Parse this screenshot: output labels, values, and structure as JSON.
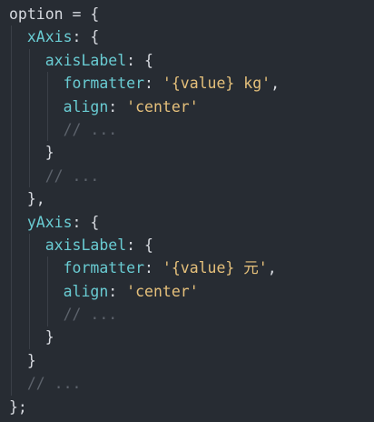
{
  "editor": {
    "background": "#272c33",
    "colors": {
      "plain": "#d7dae0",
      "key": "#69cbd2",
      "string": "#e5c07b",
      "comment": "#5d636c"
    },
    "lines": [
      {
        "indent": 0,
        "tokens": [
          {
            "t": "option = {",
            "k": "plain"
          }
        ]
      },
      {
        "indent": 1,
        "tokens": [
          {
            "t": "xAxis",
            "k": "key"
          },
          {
            "t": ": {",
            "k": "plain"
          }
        ]
      },
      {
        "indent": 2,
        "tokens": [
          {
            "t": "axisLabel",
            "k": "key"
          },
          {
            "t": ": {",
            "k": "plain"
          }
        ]
      },
      {
        "indent": 3,
        "tokens": [
          {
            "t": "formatter",
            "k": "key"
          },
          {
            "t": ": ",
            "k": "plain"
          },
          {
            "t": "'{value} kg'",
            "k": "string"
          },
          {
            "t": ",",
            "k": "plain"
          }
        ]
      },
      {
        "indent": 3,
        "tokens": [
          {
            "t": "align",
            "k": "key"
          },
          {
            "t": ": ",
            "k": "plain"
          },
          {
            "t": "'center'",
            "k": "string"
          }
        ]
      },
      {
        "indent": 3,
        "tokens": [
          {
            "t": "// ...",
            "k": "comment"
          }
        ]
      },
      {
        "indent": 2,
        "tokens": [
          {
            "t": "}",
            "k": "plain"
          }
        ]
      },
      {
        "indent": 2,
        "tokens": [
          {
            "t": "// ...",
            "k": "comment"
          }
        ]
      },
      {
        "indent": 1,
        "tokens": [
          {
            "t": "},",
            "k": "plain"
          }
        ]
      },
      {
        "indent": 1,
        "tokens": [
          {
            "t": "yAxis",
            "k": "key"
          },
          {
            "t": ": {",
            "k": "plain"
          }
        ]
      },
      {
        "indent": 2,
        "tokens": [
          {
            "t": "axisLabel",
            "k": "key"
          },
          {
            "t": ": {",
            "k": "plain"
          }
        ]
      },
      {
        "indent": 3,
        "tokens": [
          {
            "t": "formatter",
            "k": "key"
          },
          {
            "t": ": ",
            "k": "plain"
          },
          {
            "t": "'{value} 元'",
            "k": "string"
          },
          {
            "t": ",",
            "k": "plain"
          }
        ]
      },
      {
        "indent": 3,
        "tokens": [
          {
            "t": "align",
            "k": "key"
          },
          {
            "t": ": ",
            "k": "plain"
          },
          {
            "t": "'center'",
            "k": "string"
          }
        ]
      },
      {
        "indent": 3,
        "tokens": [
          {
            "t": "// ...",
            "k": "comment"
          }
        ]
      },
      {
        "indent": 2,
        "tokens": [
          {
            "t": "}",
            "k": "plain"
          }
        ]
      },
      {
        "indent": 1,
        "tokens": [
          {
            "t": "}",
            "k": "plain"
          }
        ]
      },
      {
        "indent": 1,
        "tokens": [
          {
            "t": "// ...",
            "k": "comment"
          }
        ]
      },
      {
        "indent": 0,
        "tokens": [
          {
            "t": "};",
            "k": "plain"
          }
        ]
      }
    ]
  }
}
